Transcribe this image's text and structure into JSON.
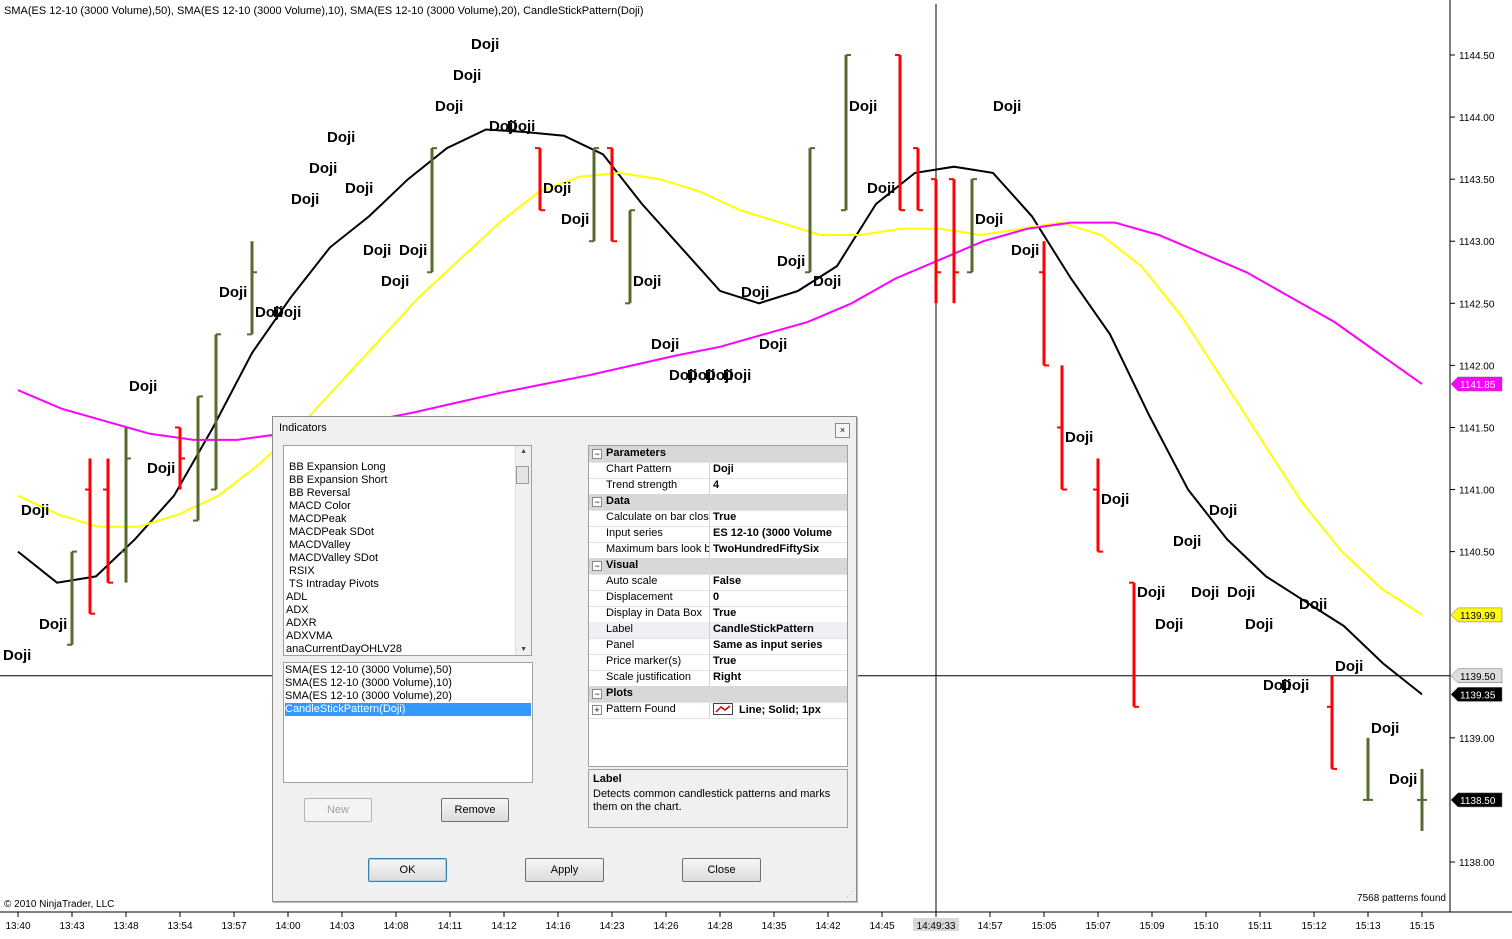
{
  "header": "SMA(ES 12-10 (3000 Volume),50), SMA(ES 12-10 (3000 Volume),10), SMA(ES 12-10 (3000 Volume),20), CandleStickPattern(Doji)",
  "copyright": "© 2010 NinjaTrader, LLC",
  "patterns_found": "7568 patterns found",
  "colors": {
    "sma10": "#000000",
    "sma20": "#ffff00",
    "sma50": "#ff00ff",
    "up_bar": "#556b2f",
    "down_bar": "#ff0000",
    "crosshair": "#000000"
  },
  "chart_data": {
    "type": "line",
    "y_axis": {
      "ticks": [
        "1144.50",
        "1144.00",
        "1143.50",
        "1143.00",
        "1142.50",
        "1142.00",
        "1141.50",
        "1141.00",
        "1140.50",
        "1139.00",
        "1138.00"
      ],
      "range": [
        1137.9,
        1144.95
      ]
    },
    "x_axis": {
      "ticks": [
        "13:40",
        "13:43",
        "13:48",
        "13:54",
        "13:57",
        "14:00",
        "14:03",
        "14:08",
        "14:11",
        "14:12",
        "14:16",
        "14:23",
        "14:26",
        "14:28",
        "14:35",
        "14:42",
        "14:45",
        "14:49:33",
        "14:57",
        "15:05",
        "15:07",
        "15:09",
        "15:10",
        "15:11",
        "15:12",
        "15:13",
        "15:15"
      ]
    },
    "price_markers": [
      {
        "value": "1141.85",
        "series": "SMA(50)",
        "color": "#ff00ff"
      },
      {
        "value": "1139.99",
        "series": "SMA(20)",
        "color": "#ffff00"
      },
      {
        "value": "1139.50",
        "series": "crosshair",
        "color": "#dddddd"
      },
      {
        "value": "1139.35",
        "series": "SMA(10)",
        "color": "#000000"
      },
      {
        "value": "1138.50",
        "series": "last price",
        "color": "#000000"
      }
    ],
    "crosshair": {
      "time": "14:49:33",
      "price": 1139.5
    },
    "bars": [
      [
        1139.75,
        1140.5,
        1139.75,
        1140.5
      ],
      [
        1141.0,
        1140.0,
        1141.25,
        1140.25
      ],
      [
        1141.0,
        1140.25,
        1141.25,
        1140.25
      ],
      [
        1140.5,
        1141.25,
        1140.25,
        1141.5
      ],
      [
        1141.5,
        1141.25,
        1141.5,
        1141.0
      ],
      [
        1140.75,
        1141.75,
        1140.75,
        1141.75
      ],
      [
        1141.0,
        1142.25,
        1141.0,
        1142.25
      ],
      [
        1142.25,
        1142.75,
        1142.25,
        1143.0
      ],
      [
        1142.75,
        1143.75,
        1142.75,
        1143.75
      ],
      [
        1143.75,
        1143.25,
        1143.75,
        1143.25
      ],
      [
        1143.0,
        1143.75,
        1143.0,
        1143.75
      ],
      [
        1143.75,
        1143.0,
        1143.75,
        1143.0
      ],
      [
        1142.5,
        1143.25,
        1142.5,
        1143.25
      ],
      [
        1142.75,
        1143.75,
        1142.75,
        1143.75
      ],
      [
        1143.25,
        1144.5,
        1143.25,
        1144.5
      ],
      [
        1144.5,
        1143.25,
        1144.5,
        1143.25
      ],
      [
        1143.75,
        1143.25,
        1143.75,
        1143.25
      ],
      [
        1143.5,
        1142.75,
        1143.5,
        1142.5
      ],
      [
        1142.75,
        1143.5,
        1142.75,
        1143.5
      ],
      [
        1143.5,
        1142.75,
        1143.5,
        1142.5
      ],
      [
        1142.75,
        1142.0,
        1143.0,
        1142.0
      ],
      [
        1141.5,
        1141.0,
        1142.0,
        1141.0
      ],
      [
        1141.0,
        1140.5,
        1141.25,
        1140.5
      ],
      [
        1140.25,
        1139.25,
        1140.25,
        1139.25
      ],
      [
        1139.25,
        1138.75,
        1139.5,
        1138.75
      ],
      [
        1138.5,
        1138.5,
        1139.0,
        1138.5
      ],
      [
        1138.5,
        1138.5,
        1138.75,
        1138.25
      ]
    ],
    "series": [
      {
        "name": "SMA(ES 12-10 (3000 Volume),10)",
        "values": [
          1140.5,
          1140.25,
          1140.3,
          1140.6,
          1140.95,
          1141.5,
          1142.1,
          1142.55,
          1142.95,
          1143.2,
          1143.5,
          1143.75,
          1143.9,
          1143.88,
          1143.85,
          1143.7,
          1143.3,
          1142.95,
          1142.6,
          1142.5,
          1142.6,
          1142.8,
          1143.3,
          1143.55,
          1143.6,
          1143.55,
          1143.2,
          1142.7,
          1142.25,
          1141.6,
          1141.0,
          1140.6,
          1140.3,
          1140.1,
          1139.9,
          1139.6,
          1139.35
        ]
      },
      {
        "name": "SMA(ES 12-10 (3000 Volume),20)",
        "values": [
          1140.95,
          1140.8,
          1140.7,
          1140.7,
          1140.8,
          1140.95,
          1141.2,
          1141.5,
          1141.85,
          1142.2,
          1142.55,
          1142.85,
          1143.15,
          1143.4,
          1143.52,
          1143.55,
          1143.5,
          1143.4,
          1143.25,
          1143.15,
          1143.05,
          1143.05,
          1143.1,
          1143.1,
          1143.05,
          1143.1,
          1143.15,
          1143.05,
          1142.8,
          1142.4,
          1141.9,
          1141.4,
          1140.9,
          1140.5,
          1140.2,
          1139.99
        ]
      },
      {
        "name": "SMA(ES 12-10 (3000 Volume),50)",
        "values": [
          1141.8,
          1141.65,
          1141.55,
          1141.45,
          1141.4,
          1141.4,
          1141.45,
          1141.5,
          1141.55,
          1141.62,
          1141.7,
          1141.78,
          1141.85,
          1141.92,
          1142.0,
          1142.08,
          1142.15,
          1142.25,
          1142.35,
          1142.5,
          1142.7,
          1142.85,
          1143.0,
          1143.1,
          1143.15,
          1143.15,
          1143.05,
          1142.9,
          1142.75,
          1142.55,
          1142.35,
          1142.1,
          1141.85
        ]
      }
    ],
    "doji_label": "Doji",
    "doji_count": 50
  },
  "dialog": {
    "title": "Indicators",
    "close_glyph": "×",
    "indicator_list": [
      "BB Expansion Long",
      "BB Expansion Short",
      "BB Reversal",
      "MACD Color",
      "MACDPeak",
      "MACDPeak SDot",
      "MACDValley",
      "MACDValley SDot",
      "RSIX",
      "TS Intraday Pivots",
      "ADL",
      "ADX",
      "ADXR",
      "ADXVMA",
      "anaCurrentDayOHLV28"
    ],
    "applied": [
      "SMA(ES 12-10 (3000 Volume),50)",
      "SMA(ES 12-10 (3000 Volume),10)",
      "SMA(ES 12-10 (3000 Volume),20)",
      "CandleStickPattern(Doji)"
    ],
    "new_label": "New",
    "remove_label": "Remove",
    "ok_label": "OK",
    "apply_label": "Apply",
    "close_label": "Close",
    "properties": [
      {
        "cat": "Parameters"
      },
      {
        "k": "Chart Pattern",
        "v": "Doji"
      },
      {
        "k": "Trend strength",
        "v": "4"
      },
      {
        "cat": "Data"
      },
      {
        "k": "Calculate on bar close",
        "v": "True"
      },
      {
        "k": "Input series",
        "v": "ES 12-10 (3000 Volume"
      },
      {
        "k": "Maximum bars look back",
        "v": "TwoHundredFiftySix"
      },
      {
        "cat": "Visual"
      },
      {
        "k": "Auto scale",
        "v": "False"
      },
      {
        "k": "Displacement",
        "v": "0"
      },
      {
        "k": "Display in Data Box",
        "v": "True"
      },
      {
        "k": "Label",
        "v": "CandleStickPattern",
        "sel": true
      },
      {
        "k": "Panel",
        "v": "Same as input series"
      },
      {
        "k": "Price marker(s)",
        "v": "True"
      },
      {
        "k": "Scale justification",
        "v": "Right"
      },
      {
        "cat": "Plots"
      },
      {
        "k": "Pattern Found",
        "v": "Line; Solid; 1px",
        "plus": true
      }
    ],
    "desc_title": "Label",
    "desc_text": "Detects common candlestick patterns and marks them on the chart."
  }
}
